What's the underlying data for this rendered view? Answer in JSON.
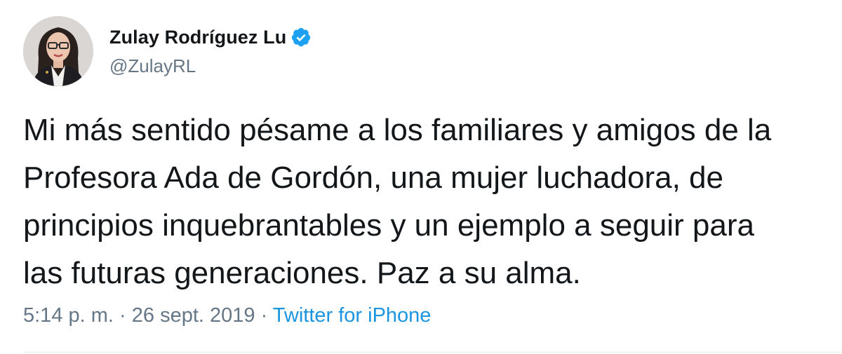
{
  "tweet": {
    "author": {
      "name": "Zulay Rodríguez Lu",
      "handle": "@ZulayRL",
      "verified": true,
      "avatar_icon": "profile-photo"
    },
    "text": "Mi más sentido pésame a los familiares y amigos de la\nProfesora Ada de Gordón, una mujer luchadora, de\nprincipios inquebrantables y un ejemplo a seguir para\nlas futuras generaciones. Paz a su alma.",
    "time": "5:14 p. m.",
    "separator1": " · ",
    "date": "26 sept. 2019",
    "separator2": " · ",
    "source": "Twitter for iPhone"
  },
  "colors": {
    "text": "#14171a",
    "secondary": "#657786",
    "link": "#1b95e0",
    "verified": "#1da1f2",
    "divider": "#e6ecf0"
  }
}
